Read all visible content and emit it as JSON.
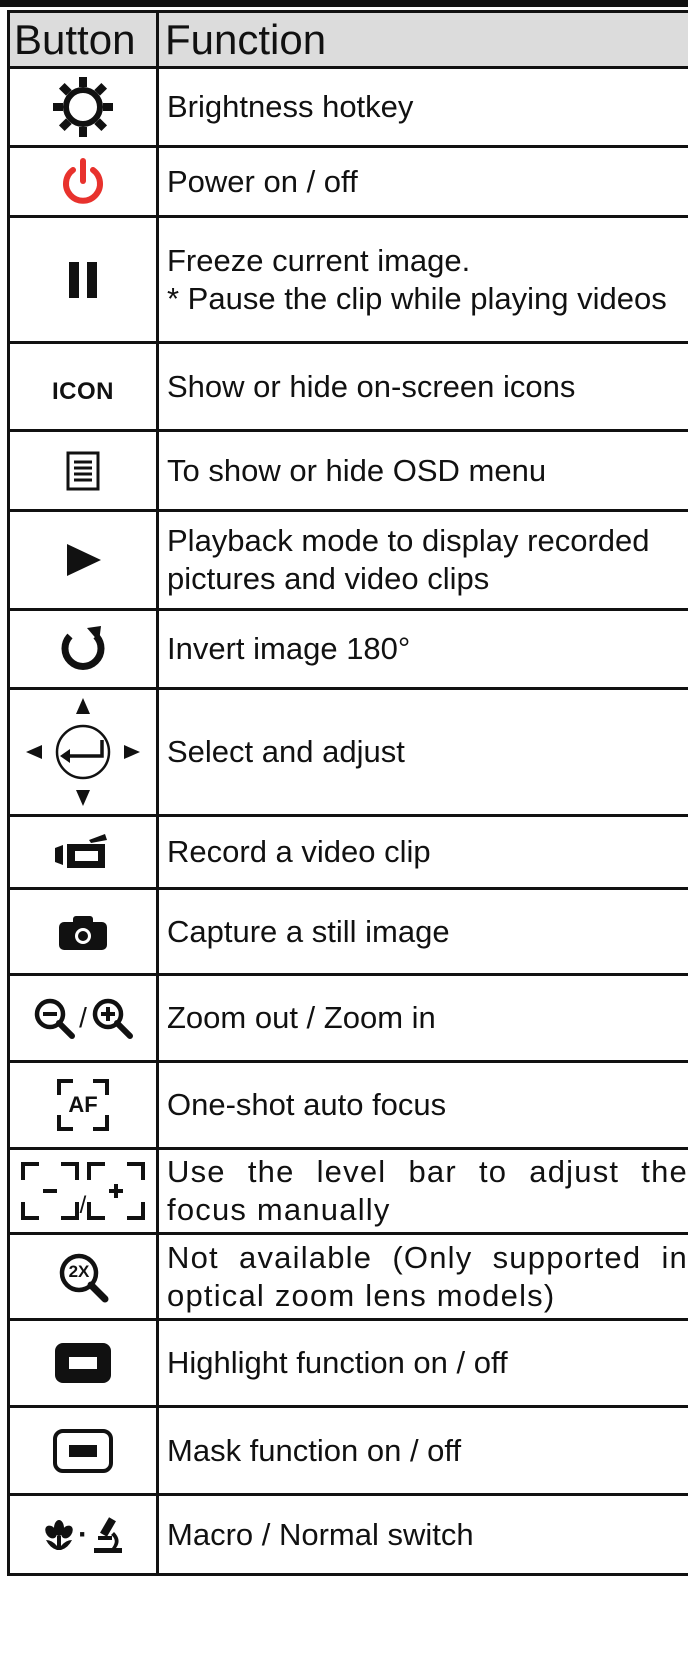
{
  "table": {
    "header": {
      "button": "Button",
      "function": "Function"
    },
    "rows": [
      {
        "icon": "brightness-icon",
        "text": "Brightness hotkey"
      },
      {
        "icon": "power-icon",
        "text": "Power on / off"
      },
      {
        "icon": "pause-icon",
        "line1": "Freeze current image.",
        "line2": "* Pause the clip while playing videos"
      },
      {
        "icon": "icon-text-icon",
        "icon_label": "ICON",
        "text": "Show or hide on-screen icons"
      },
      {
        "icon": "menu-icon",
        "text": "To show or hide OSD menu"
      },
      {
        "icon": "play-icon",
        "text": "Playback mode to display recorded pictures and video clips"
      },
      {
        "icon": "rotate-icon",
        "text": "Invert image 180°"
      },
      {
        "icon": "dpad-enter-icon",
        "text": "Select and adjust"
      },
      {
        "icon": "video-camera-icon",
        "text": "Record a video clip"
      },
      {
        "icon": "camera-icon",
        "text": "Capture a still image"
      },
      {
        "icon": "zoom-out-in-icon",
        "icon_sep": "/",
        "text": "Zoom out / Zoom in"
      },
      {
        "icon": "autofocus-icon",
        "icon_label": "AF",
        "text": "One-shot auto focus"
      },
      {
        "icon": "focus-minus-plus-icon",
        "icon_sep": "/",
        "text": "Use the level bar to adjust the focus manually"
      },
      {
        "icon": "zoom-2x-icon",
        "icon_label": "2X",
        "text": "Not available (Only supported in optical zoom lens models)"
      },
      {
        "icon": "highlight-icon",
        "text": "Highlight function on / off"
      },
      {
        "icon": "mask-icon",
        "text": "Mask function on / off"
      },
      {
        "icon": "macro-normal-icon",
        "icon_sep": "·",
        "text": "Macro / Normal switch"
      }
    ]
  },
  "colors": {
    "power_red": "#e8322d",
    "header_bg": "#dcdcdc",
    "border": "#111111"
  }
}
